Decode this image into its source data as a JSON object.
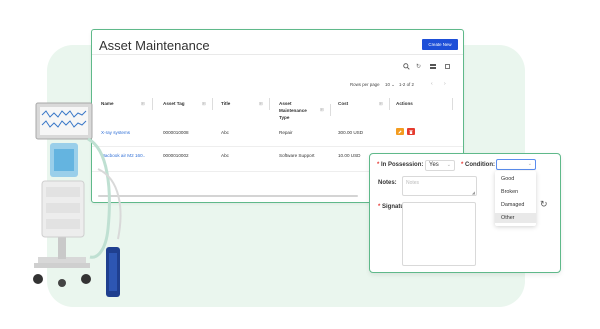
{
  "page": {
    "title": "Asset Maintenance",
    "create_label": "Create New"
  },
  "toolbar": {
    "icons": [
      "search-icon",
      "refresh-icon",
      "columns-icon",
      "fullscreen-icon"
    ],
    "refresh_glyph": "↻"
  },
  "pagination": {
    "rows_label": "Rows per page",
    "page_size": "10 ⌄",
    "range": "1-2 of 2",
    "prev": "‹",
    "next": "›"
  },
  "table": {
    "columns": [
      "Name",
      "Asset Tag",
      "Title",
      "Asset Maintenance Type",
      "Cost",
      "Actions"
    ],
    "rows": [
      {
        "name": "X-ray systems",
        "tag": "0000010008",
        "title": "Abc",
        "type": "Repair",
        "cost": "300.00 USD"
      },
      {
        "name": "Macbook air M2 160..",
        "tag": "0000010002",
        "title": "Abc",
        "type": "Software Support",
        "cost": "10.00 USD"
      }
    ],
    "filter_glyph": "⊞"
  },
  "form": {
    "possession_label": "In Possession:",
    "possession_value": "Yes",
    "condition_label": "Condition:",
    "condition_value": "",
    "notes_label": "Notes:",
    "notes_placeholder": "Notes",
    "signature_label": "Signature:",
    "condition_options": [
      "Good",
      "Broken",
      "Damaged",
      "Other"
    ],
    "selected_option_index": 3,
    "reset_glyph": "↻"
  },
  "colors": {
    "accent": "#5fb98a",
    "primary_button": "#1d4fd8",
    "edit_button": "#f39c20",
    "delete_button": "#e53b2f",
    "link": "#2f6fd6",
    "background_shape": "#eaf6ee"
  }
}
